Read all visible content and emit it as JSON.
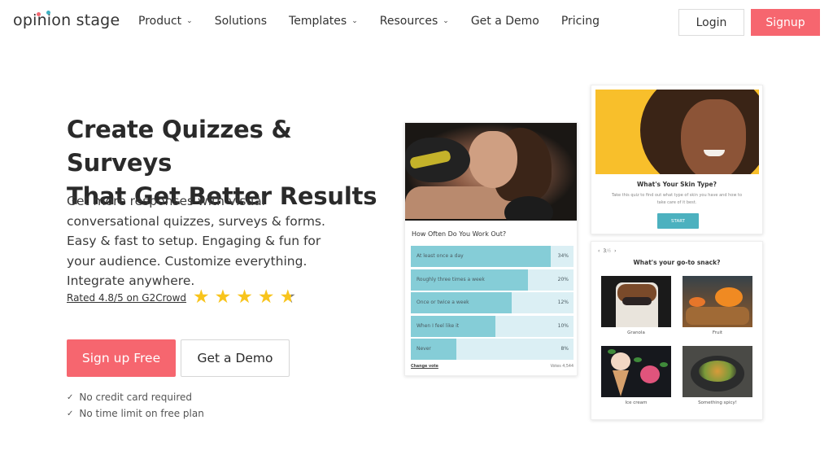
{
  "brand": {
    "logo_text": "opinion stage",
    "accent_color": "#f6666f",
    "teal_color": "#4cb1bf"
  },
  "nav": {
    "items": [
      {
        "label": "Product",
        "has_dropdown": true,
        "chevron": "⌄"
      },
      {
        "label": "Solutions",
        "has_dropdown": false
      },
      {
        "label": "Templates",
        "has_dropdown": true,
        "chevron": "⌄"
      },
      {
        "label": "Resources",
        "has_dropdown": true,
        "chevron": "⌄"
      },
      {
        "label": "Get a Demo",
        "has_dropdown": false
      },
      {
        "label": "Pricing",
        "has_dropdown": false
      }
    ],
    "login_label": "Login",
    "signup_label": "Signup"
  },
  "hero": {
    "headline_line1": "Create Quizzes & Surveys",
    "headline_line2": "That Get Better Results",
    "subtext": "Get more responses with visual conversational quizzes, surveys & forms. Easy & fast to setup. Engaging & fun for your audience. Customize everything. Integrate anywhere.",
    "rating_text": "Rated 4.8/5 on G2Crowd",
    "rating_value": 4.8,
    "rating_max": 5,
    "star_glyph": "★",
    "primary_cta": "Sign up Free",
    "secondary_cta": "Get a Demo",
    "checks": [
      {
        "icon": "✓",
        "text": "No credit card required"
      },
      {
        "icon": "✓",
        "text": "No time limit on free plan"
      }
    ]
  },
  "poll": {
    "question": "How Often Do You Work Out?",
    "options": [
      {
        "label": "At least once a day",
        "percent_label": "34%",
        "fill": 0.86
      },
      {
        "label": "Roughly three times a week",
        "percent_label": "20%",
        "fill": 0.72
      },
      {
        "label": "Once or twice a week",
        "percent_label": "12%",
        "fill": 0.62
      },
      {
        "label": "When I feel like it",
        "percent_label": "10%",
        "fill": 0.52
      },
      {
        "label": "Never",
        "percent_label": "8%",
        "fill": 0.28
      }
    ],
    "change_vote": "Change vote",
    "votes": "Votes 4,544"
  },
  "quiz": {
    "title": "What's Your Skin Type?",
    "description": "Take this quiz to find out what type of skin you have and how to take care of it best.",
    "start_label": "START"
  },
  "snack": {
    "prev_icon": "‹",
    "next_icon": "›",
    "current": "3",
    "total": "/6",
    "question": "What's your go-to snack?",
    "options": [
      {
        "label": "Granola"
      },
      {
        "label": "Fruit"
      },
      {
        "label": "Ice cream"
      },
      {
        "label": "Something spicy!"
      }
    ]
  }
}
